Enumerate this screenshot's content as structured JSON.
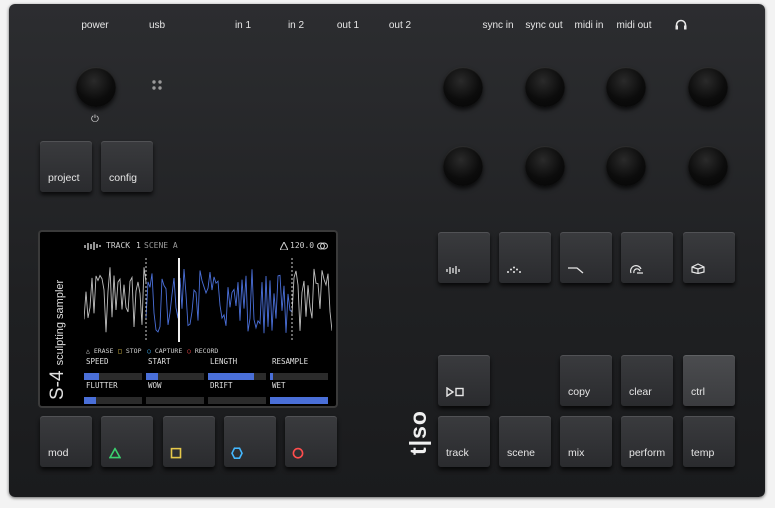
{
  "ports": {
    "power": "power",
    "usb": "usb",
    "in1": "in 1",
    "in2": "in 2",
    "out1": "out 1",
    "out2": "out 2",
    "sync_in": "sync in",
    "sync_out": "sync out",
    "midi_in": "midi in",
    "midi_out": "midi out",
    "headphones_icon": "headphones-icon"
  },
  "power_symbol": "⏻",
  "left_buttons": {
    "project": "project",
    "config": "config"
  },
  "screen": {
    "device_name": "S-4",
    "device_subtitle": "sculpting sampler",
    "track_label": "TRACK",
    "track_number": "1",
    "scene_label": "SCENE A",
    "tempo": "120.0",
    "modes": {
      "erase": "ERASE",
      "stop": "STOP",
      "capture": "CAPTURE",
      "record": "RECORD"
    },
    "params": [
      {
        "name": "SPEED",
        "level": 0.25
      },
      {
        "name": "START",
        "level": 0.2
      },
      {
        "name": "LENGTH",
        "level": 0.8
      },
      {
        "name": "RESAMPLE",
        "level": 0.05
      },
      {
        "name": "FLUTTER",
        "level": 0.2
      },
      {
        "name": "WOW",
        "level": 0.0
      },
      {
        "name": "DRIFT",
        "level": 0.0
      },
      {
        "name": "WET",
        "level": 1.0
      }
    ]
  },
  "bottom_left": {
    "mod": "mod",
    "triangle_color": "#3bd16f",
    "square_color": "#e6c84a",
    "hexagon_color": "#44b8ff",
    "circle_color": "#ff4d4d"
  },
  "brand": "t|so",
  "right_keys": {
    "row1_icons": [
      "waveform-icon",
      "dots-icon",
      "filter-icon",
      "fx-loop-icon",
      "cube-icon"
    ],
    "play_stop_icon": "play-stop-icon",
    "copy": "copy",
    "clear": "clear",
    "ctrl": "ctrl",
    "track": "track",
    "scene": "scene",
    "mix": "mix",
    "perform": "perform",
    "temp": "temp"
  },
  "colors": {
    "accent_blue": "#4a6fd8",
    "wave_grey": "#bfbfbf"
  }
}
